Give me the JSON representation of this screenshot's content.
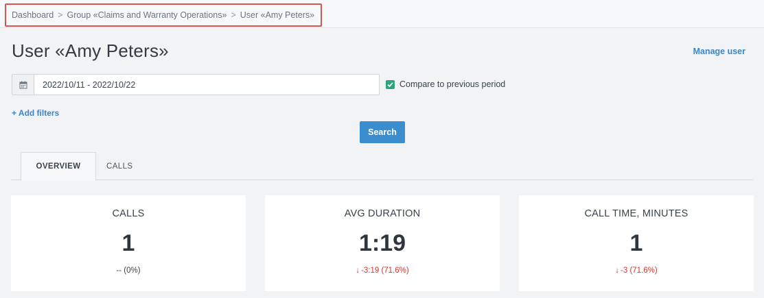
{
  "breadcrumb": {
    "items": [
      "Dashboard",
      "Group «Claims and Warranty Operations»",
      "User «Amy Peters»"
    ],
    "separator": ">"
  },
  "header": {
    "title": "User «Amy Peters»",
    "manage_user": "Manage user"
  },
  "filters": {
    "date_range": "2022/10/11 - 2022/10/22",
    "compare_label": "Compare to previous period",
    "compare_checked": true,
    "add_filters": "+ Add filters",
    "search_label": "Search"
  },
  "tabs": [
    {
      "label": "OVERVIEW",
      "active": true
    },
    {
      "label": "CALLS",
      "active": false
    }
  ],
  "cards": [
    {
      "label": "CALLS",
      "value": "1",
      "delta": "-- (0%)",
      "trend": "none"
    },
    {
      "label": "AVG DURATION",
      "value": "1:19",
      "delta": "-3:19 (71.6%)",
      "trend": "down"
    },
    {
      "label": "CALL TIME, MINUTES",
      "value": "1",
      "delta": "-3 (71.6%)",
      "trend": "down"
    }
  ],
  "colors": {
    "accent": "#3b86c6",
    "button": "#3a8ed0",
    "negative": "#c8392f",
    "checkbox": "#2fa37a",
    "highlight_border": "#d9534f"
  },
  "icons": {
    "date": "calendar-icon",
    "check": "check-icon",
    "down_arrow": "arrow-down-icon"
  }
}
